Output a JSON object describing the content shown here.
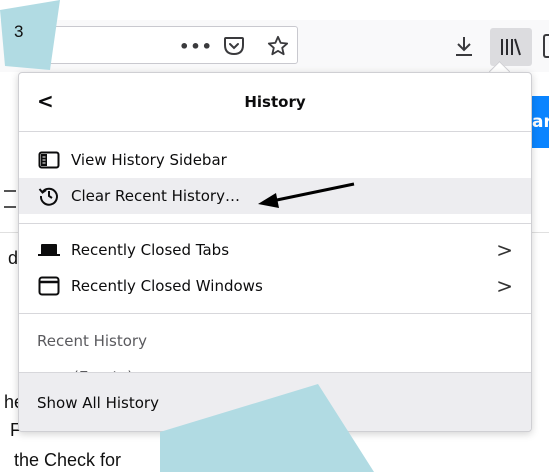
{
  "step_badge": "3",
  "toolbar": {
    "icons": [
      "more-icon",
      "pocket-icon",
      "bookmark-star-icon",
      "download-icon",
      "library-icon"
    ]
  },
  "background_page": {
    "button_text": "ar",
    "fragments": [
      "d",
      "he",
      "F",
      "the Check for"
    ]
  },
  "panel": {
    "title": "History",
    "items": [
      {
        "label": "View History Sidebar",
        "icon": "sidebar-icon"
      },
      {
        "label": "Clear Recent History…",
        "icon": "history-clock-icon"
      },
      {
        "label": "Recently Closed Tabs",
        "icon": "tab-icon"
      },
      {
        "label": "Recently Closed Windows",
        "icon": "window-icon"
      }
    ],
    "recent_history_label": "Recent History",
    "empty_label": "(Empty)",
    "footer_label": "Show All History"
  },
  "colors": {
    "accent": "#0a84ff",
    "highlight": "#ededf0",
    "overlay": "#b1dbe3"
  }
}
